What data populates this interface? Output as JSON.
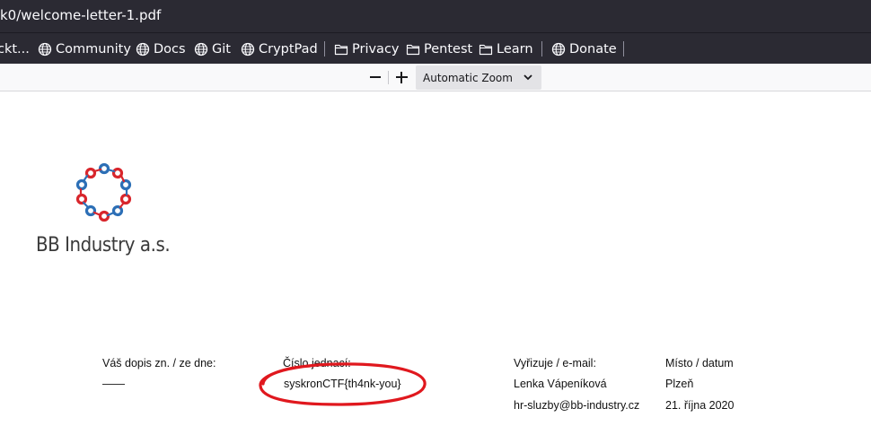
{
  "browser": {
    "url_text": "k0/welcome-letter-1.pdf",
    "bookmarks": [
      {
        "label": "ckt...",
        "icon": "globe-icon"
      },
      {
        "label": "Community",
        "icon": "globe-icon"
      },
      {
        "label": "Docs",
        "icon": "globe-icon"
      },
      {
        "label": "Git",
        "icon": "globe-icon"
      },
      {
        "label": "CryptPad",
        "icon": "globe-icon"
      },
      {
        "label": "Privacy",
        "icon": "folder-icon"
      },
      {
        "label": "Pentest",
        "icon": "folder-icon"
      },
      {
        "label": "Learn",
        "icon": "folder-icon"
      },
      {
        "label": "Donate",
        "icon": "globe-icon"
      }
    ]
  },
  "pdf_toolbar": {
    "zoom_selected": "Automatic Zoom"
  },
  "document": {
    "company_name": "BB Industry a.s.",
    "logo_colors": {
      "red": "#d8262c",
      "blue": "#2c6fb6"
    },
    "columns": [
      {
        "header": "Váš dopis zn. / ze dne:",
        "rows": [
          "——"
        ]
      },
      {
        "header": "Číslo jednací:",
        "rows": [
          "syskronCTF{th4nk-you}"
        ]
      },
      {
        "header": "Vyřizuje / e-mail:",
        "rows": [
          "Lenka Vápeníková",
          "hr-sluzby@bb-industry.cz"
        ]
      },
      {
        "header": "Místo / datum",
        "rows": [
          "Plzeň",
          "21. října 2020"
        ]
      }
    ],
    "annotation_color": "#e0181e"
  }
}
